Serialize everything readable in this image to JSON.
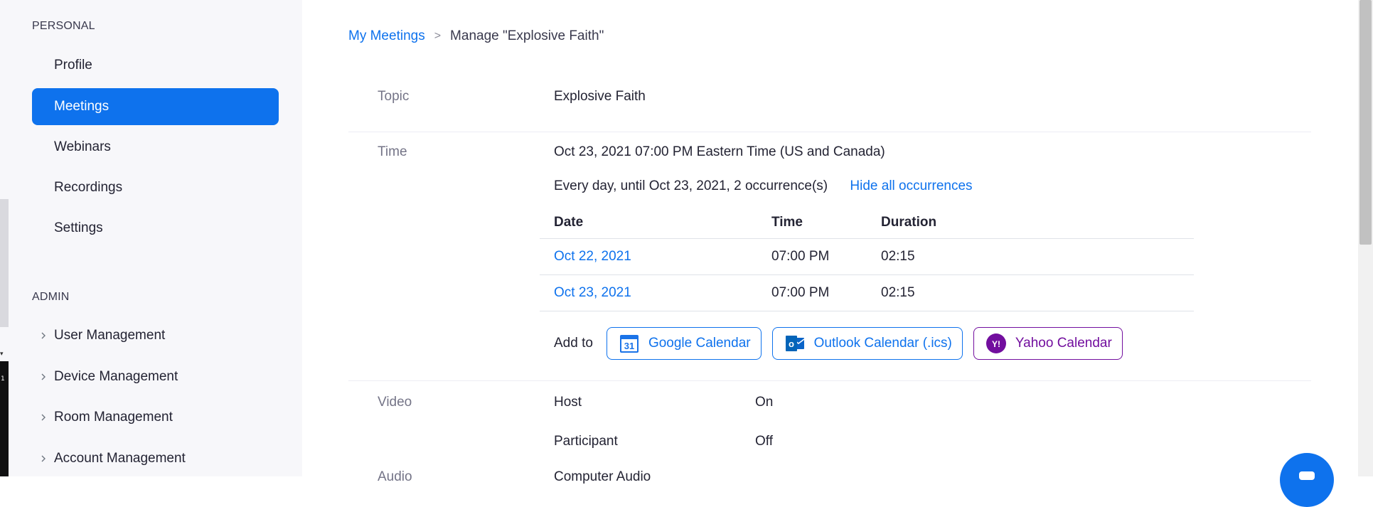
{
  "sidebar": {
    "personal_title": "PERSONAL",
    "personal_items": [
      {
        "label": "Profile"
      },
      {
        "label": "Meetings",
        "active": true
      },
      {
        "label": "Webinars"
      },
      {
        "label": "Recordings"
      },
      {
        "label": "Settings"
      }
    ],
    "admin_title": "ADMIN",
    "admin_items": [
      {
        "label": "User Management"
      },
      {
        "label": "Device Management"
      },
      {
        "label": "Room Management"
      },
      {
        "label": "Account Management"
      }
    ]
  },
  "breadcrumb": {
    "parent": "My Meetings",
    "separator": ">",
    "current": "Manage \"Explosive Faith\""
  },
  "meeting": {
    "topic_label": "Topic",
    "topic_value": "Explosive Faith",
    "time_label": "Time",
    "time_value": "Oct 23, 2021 07:00 PM Eastern Time (US and Canada)",
    "recurrence_text": "Every day, until Oct 23, 2021, 2 occurrence(s)",
    "hide_occurrences_link": "Hide all occurrences",
    "occurrences": {
      "headers": {
        "date": "Date",
        "time": "Time",
        "duration": "Duration"
      },
      "rows": [
        {
          "date": "Oct 22, 2021",
          "time": "07:00 PM",
          "duration": "02:15"
        },
        {
          "date": "Oct 23, 2021",
          "time": "07:00 PM",
          "duration": "02:15"
        }
      ]
    },
    "add_to_label": "Add to",
    "calendars": {
      "google": "Google Calendar",
      "google_icon_text": "31",
      "outlook": "Outlook Calendar (.ics)",
      "outlook_icon_text": "o",
      "yahoo": "Yahoo Calendar",
      "yahoo_icon_text": "Y!"
    },
    "video_label": "Video",
    "video_host_label": "Host",
    "video_host_value": "On",
    "video_participant_label": "Participant",
    "video_participant_value": "Off",
    "audio_label": "Audio",
    "audio_value": "Computer Audio"
  },
  "left_strip_number": "1",
  "colors": {
    "accent": "#0e72ed",
    "yahoo": "#720e9e",
    "sidebar_bg": "#f7f7fa"
  }
}
